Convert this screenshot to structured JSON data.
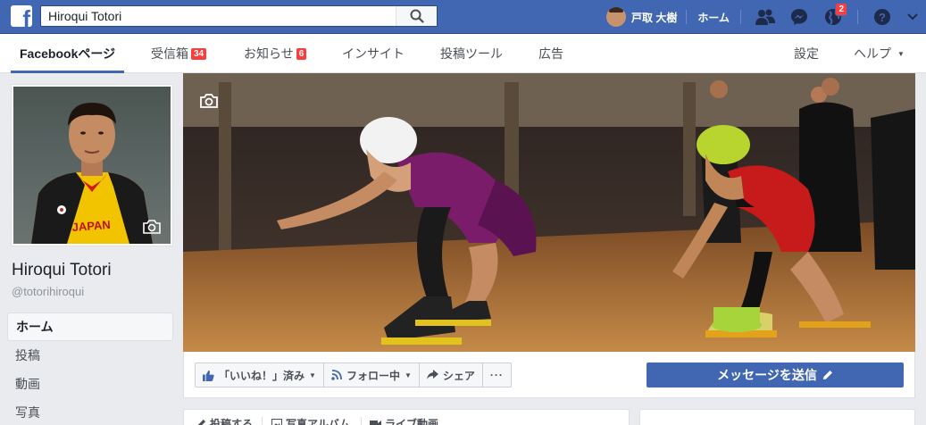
{
  "search": {
    "value": "Hiroqui Totori"
  },
  "topbar": {
    "user_name": "戸取 大樹",
    "home_label": "ホーム",
    "notification_count": "2"
  },
  "page_nav": {
    "items": [
      {
        "label": "Facebookページ"
      },
      {
        "label": "受信箱",
        "badge": "34"
      },
      {
        "label": "お知らせ",
        "badge": "6"
      },
      {
        "label": "インサイト"
      },
      {
        "label": "投稿ツール"
      },
      {
        "label": "広告"
      }
    ],
    "settings_label": "設定",
    "help_label": "ヘルプ"
  },
  "page": {
    "name": "Hiroqui Totori",
    "handle": "@totorihiroqui"
  },
  "side_nav": [
    {
      "label": "ホーム"
    },
    {
      "label": "投稿"
    },
    {
      "label": "動画"
    },
    {
      "label": "写真"
    }
  ],
  "actions": {
    "like_label": "「いいね！」済み",
    "follow_label": "フォロー中",
    "share_label": "シェア",
    "more_label": "···",
    "message_label": "メッセージを送信"
  },
  "composer": {
    "post_label": "投稿する",
    "album_label": "写真アルバム",
    "live_label": "ライブ動画"
  },
  "colors": {
    "brand": "#4267b2",
    "badge": "#fa3e3e"
  }
}
